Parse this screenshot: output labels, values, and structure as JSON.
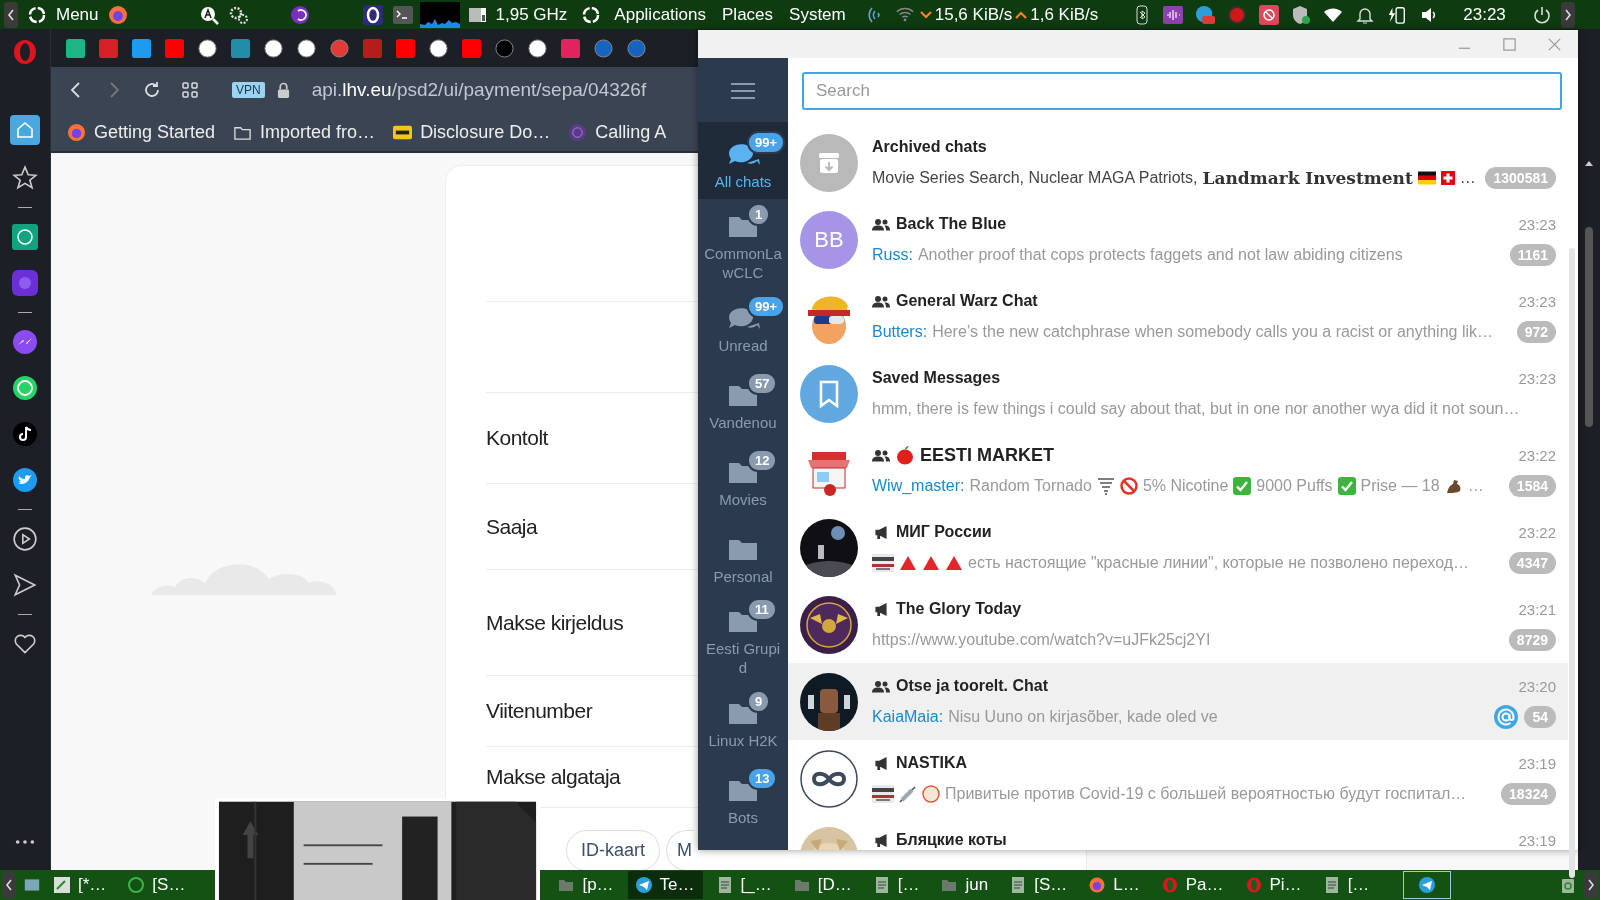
{
  "top_panel": {
    "menu": "Menu",
    "cpu": "1,95 GHz",
    "menus": [
      "Applications",
      "Places",
      "System"
    ],
    "net_down": "15,6 KiB/s",
    "net_up": "1,6 KiB/s",
    "clock": "23:23"
  },
  "browser": {
    "vpn": "VPN",
    "url_prefix": "api.",
    "url_host": "lhv.eu",
    "url_path": "/psd2/ui/payment/sepa/04326f",
    "bookmarks": [
      {
        "kind": "browser",
        "label": "Getting Started"
      },
      {
        "kind": "folder",
        "label": "Imported fro…"
      },
      {
        "kind": "imdb",
        "label": "Disclosure Do…"
      },
      {
        "kind": "spiral",
        "label": "Calling A"
      }
    ],
    "page": {
      "fields": [
        "Kontolt",
        "Saaja",
        "Makse kirjeldus",
        "Viitenumber",
        "Makse algataja"
      ],
      "buttons": [
        "ID-kaart",
        "M"
      ]
    }
  },
  "telegram": {
    "search_placeholder": "Search",
    "folders": [
      {
        "kind": "chats",
        "label": "All chats",
        "badge": "99+",
        "muted": false,
        "selected": true
      },
      {
        "kind": "folder",
        "label": "CommonLawCLC",
        "badge": "1",
        "muted": true,
        "selected": false
      },
      {
        "kind": "chats",
        "label": "Unread",
        "badge": "99+",
        "muted": false,
        "selected": false
      },
      {
        "kind": "folder",
        "label": "Vandenou",
        "badge": "57",
        "muted": true,
        "selected": false
      },
      {
        "kind": "folder",
        "label": "Movies",
        "badge": "12",
        "muted": true,
        "selected": false
      },
      {
        "kind": "folder",
        "label": "Personal",
        "selected": false
      },
      {
        "kind": "folder",
        "label": "Eesti Grupid",
        "badge": "11",
        "muted": true,
        "selected": false
      },
      {
        "kind": "folder",
        "label": "Linux H2K",
        "badge": "9",
        "muted": true,
        "selected": false
      },
      {
        "kind": "folder",
        "label": "Bots",
        "badge": "13",
        "muted": false,
        "selected": false
      }
    ],
    "chats": [
      {
        "kind": "archive",
        "name": "Archived chats",
        "preview": [
          {
            "kind": "text",
            "text": "Movie Series Search, Nuclear MAGA Patriots, "
          },
          {
            "kind": "fancy",
            "text": "Landmark Investment"
          },
          {
            "kind": "flag-de"
          },
          {
            "kind": "flag-ch"
          },
          {
            "kind": "text",
            "text": "…"
          }
        ],
        "count": "1300581",
        "muted": true,
        "hovered": false,
        "avatar": {
          "kind": "archive"
        }
      },
      {
        "kind": "group",
        "name": "Back The Blue",
        "time": "23:23",
        "sender": "Russ:",
        "preview": [
          {
            "kind": "text",
            "text": "Another proof that cops protects faggets and not law abiding citizens"
          }
        ],
        "count": "1161",
        "muted": true,
        "hovered": false,
        "avatar": {
          "kind": "initials",
          "text": "BB",
          "color": "#a695e7"
        }
      },
      {
        "kind": "group",
        "name": "General Warz Chat",
        "time": "23:23",
        "sender": "Butters:",
        "preview": [
          {
            "kind": "text",
            "text": "Here’s the new catchphrase when somebody calls you a racist or anything lik…"
          }
        ],
        "count": "972",
        "muted": true,
        "hovered": false,
        "avatar": {
          "kind": "flagband"
        }
      },
      {
        "kind": "saved",
        "name": "Saved Messages",
        "time": "23:23",
        "preview": [
          {
            "kind": "text",
            "text": "hmm, there is few things i could say about that, but in one nor another wya did it not soun…"
          }
        ],
        "hovered": false,
        "avatar": {
          "kind": "saved"
        }
      },
      {
        "kind": "group",
        "name_icons": [
          {
            "kind": "apple"
          }
        ],
        "name": "EESTI MARKET",
        "time": "23:22",
        "sender": "Wiw_master:",
        "preview": [
          {
            "kind": "text",
            "text": "Random Tornado"
          },
          {
            "kind": "tornado"
          },
          {
            "kind": "no18"
          },
          {
            "kind": "text",
            "text": "5% Nicotine"
          },
          {
            "kind": "check"
          },
          {
            "kind": "text",
            "text": "9000 Puffs"
          },
          {
            "kind": "check"
          },
          {
            "kind": "text",
            "text": "Prise — 18"
          },
          {
            "kind": "muscle"
          },
          {
            "kind": "text",
            "text": "…"
          }
        ],
        "count": "1584",
        "muted": true,
        "hovered": false,
        "avatar": {
          "kind": "market"
        }
      },
      {
        "kind": "channel",
        "name": "МИГ России",
        "time": "23:22",
        "preview": [
          {
            "kind": "thumb"
          },
          {
            "kind": "triangle"
          },
          {
            "kind": "triangle"
          },
          {
            "kind": "triangle"
          },
          {
            "kind": "text",
            "text": "есть настоящие \"красные линии\", которые не позволено переход…"
          }
        ],
        "count": "4347",
        "muted": true,
        "hovered": false,
        "avatar": {
          "kind": "night"
        }
      },
      {
        "kind": "channel",
        "name": "The Glory Today",
        "time": "23:21",
        "preview": [
          {
            "kind": "text",
            "text": "https://www.youtube.com/watch?v=uJFk25cj2YI"
          }
        ],
        "count": "8729",
        "muted": true,
        "hovered": false,
        "avatar": {
          "kind": "crest"
        }
      },
      {
        "kind": "group",
        "name": "Otse ja toorelt. Chat",
        "time": "23:20",
        "sender": "KaiaMaia:",
        "preview": [
          {
            "kind": "text",
            "text": "Nisu Uuno on kirjasõber, kade oled ve"
          }
        ],
        "mention": true,
        "count": "54",
        "muted": true,
        "hovered": true,
        "avatar": {
          "kind": "dark"
        }
      },
      {
        "kind": "channel",
        "name": "NASTIKA",
        "time": "23:19",
        "preview": [
          {
            "kind": "thumb"
          },
          {
            "kind": "syringe"
          },
          {
            "kind": "round"
          },
          {
            "kind": "text",
            "text": "Привитые против Covid-19 с большей вероятностью будут госпитал…"
          }
        ],
        "count": "18324",
        "muted": true,
        "hovered": false,
        "avatar": {
          "kind": "infinity"
        }
      },
      {
        "kind": "channel",
        "name": "Бляцкие коты",
        "time": "23:19",
        "hovered": false,
        "avatar": {
          "kind": "cat"
        }
      }
    ]
  },
  "taskbar": {
    "tasks": [
      {
        "label": "[*…",
        "kind": "editor",
        "active": false
      },
      {
        "label": "[S…",
        "kind": "green",
        "active": false
      },
      {
        "label": "[p…",
        "kind": "folder",
        "active": false
      },
      {
        "label": "Te…",
        "kind": "telegram",
        "active": true
      },
      {
        "label": "[_…",
        "kind": "doc",
        "active": false
      },
      {
        "label": "[D…",
        "kind": "folder",
        "active": false
      },
      {
        "label": "[…",
        "kind": "doc",
        "active": false
      },
      {
        "label": "jun",
        "kind": "folder",
        "active": false
      },
      {
        "label": "[S…",
        "kind": "doc",
        "active": false
      },
      {
        "label": "L…",
        "kind": "browser",
        "active": false
      },
      {
        "label": "Pa…",
        "kind": "opera",
        "active": false
      },
      {
        "label": "Pi…",
        "kind": "opera",
        "active": false
      },
      {
        "label": "[…",
        "kind": "doc",
        "active": false
      }
    ]
  }
}
